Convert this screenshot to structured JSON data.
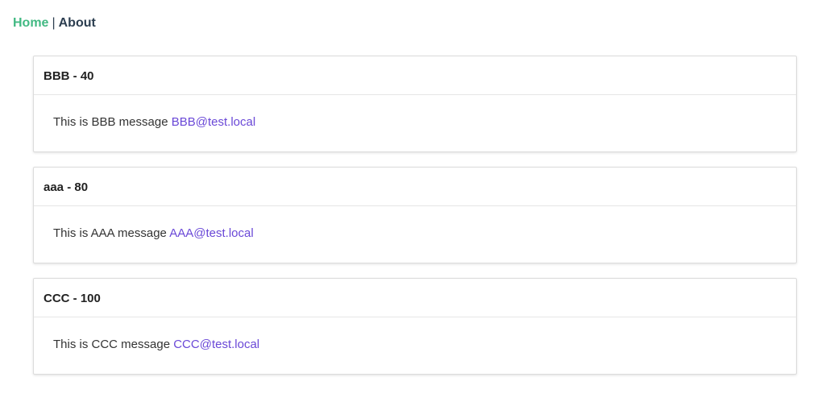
{
  "nav": {
    "home_label": "Home",
    "separator": "|",
    "about_label": "About"
  },
  "colors": {
    "home_link": "#42b983",
    "email_link": "#6a48d7"
  },
  "cards": [
    {
      "title": "BBB - 40",
      "message": "This is BBB message",
      "email": "BBB@test.local"
    },
    {
      "title": "aaa - 80",
      "message": "This is AAA message",
      "email": "AAA@test.local"
    },
    {
      "title": "CCC - 100",
      "message": "This is CCC message",
      "email": "CCC@test.local"
    }
  ]
}
